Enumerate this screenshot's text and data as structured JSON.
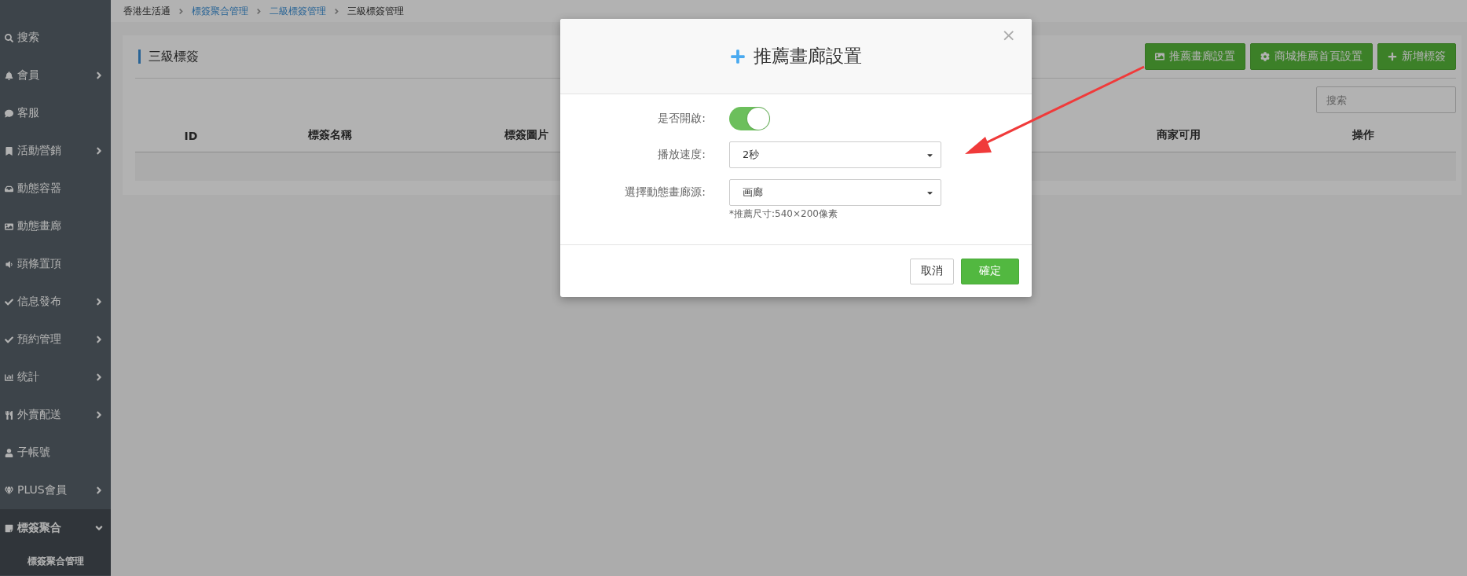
{
  "sidebar": {
    "items": [
      {
        "label": "搜索",
        "submenu": false,
        "selected": false
      },
      {
        "label": "會員",
        "submenu": true,
        "expanded": false,
        "selected": false
      },
      {
        "label": "客服",
        "submenu": false,
        "selected": false
      },
      {
        "label": "活動營銷",
        "submenu": true,
        "expanded": false,
        "selected": false
      },
      {
        "label": "動態容器",
        "submenu": false,
        "selected": false
      },
      {
        "label": "動態畫廊",
        "submenu": false,
        "selected": false
      },
      {
        "label": "頭條置頂",
        "submenu": false,
        "selected": false
      },
      {
        "label": "信息發布",
        "submenu": true,
        "expanded": false,
        "selected": false
      },
      {
        "label": "預約管理",
        "submenu": true,
        "expanded": false,
        "selected": false
      },
      {
        "label": "统計",
        "submenu": true,
        "expanded": false,
        "selected": false
      },
      {
        "label": "外賣配送",
        "submenu": true,
        "expanded": false,
        "selected": false
      },
      {
        "label": "子帳號",
        "submenu": false,
        "selected": false
      },
      {
        "label": "PLUS會員",
        "submenu": true,
        "expanded": false,
        "selected": false
      },
      {
        "label": "標簽聚合",
        "submenu": true,
        "expanded": true,
        "selected": true,
        "children": [
          {
            "label": "標簽聚合管理",
            "selected": true
          }
        ]
      }
    ]
  },
  "breadcrumb": [
    {
      "label": "香港生活通",
      "link": false
    },
    {
      "label": "標簽聚合管理",
      "link": true
    },
    {
      "label": "二級標簽管理",
      "link": true
    },
    {
      "label": "三級標簽管理",
      "link": false
    }
  ],
  "panel": {
    "title": "三級標簽",
    "buttons": [
      {
        "label": "推薦畫廊設置"
      },
      {
        "label": "商城推薦首頁設置"
      },
      {
        "label": "新增標簽"
      }
    ],
    "search": {
      "placeholder": "搜索"
    },
    "table": {
      "columns": [
        "ID",
        "標簽名稱",
        "標簽圖片",
        "商家可用",
        "操作"
      ]
    }
  },
  "modal": {
    "title": "推薦畫廊設置",
    "close": "×",
    "fields": [
      {
        "kind": "switch",
        "label": "是否開啟:",
        "on": true
      },
      {
        "kind": "select",
        "label": "播放速度:",
        "value": "2秒"
      },
      {
        "kind": "select",
        "label": "選擇動態畫廊源:",
        "value": "画廊",
        "hint": "*推薦尺寸:540×200像素"
      }
    ],
    "buttons": [
      {
        "label": "取消",
        "kind": "default"
      },
      {
        "label": "確定",
        "kind": "primary"
      }
    ]
  }
}
